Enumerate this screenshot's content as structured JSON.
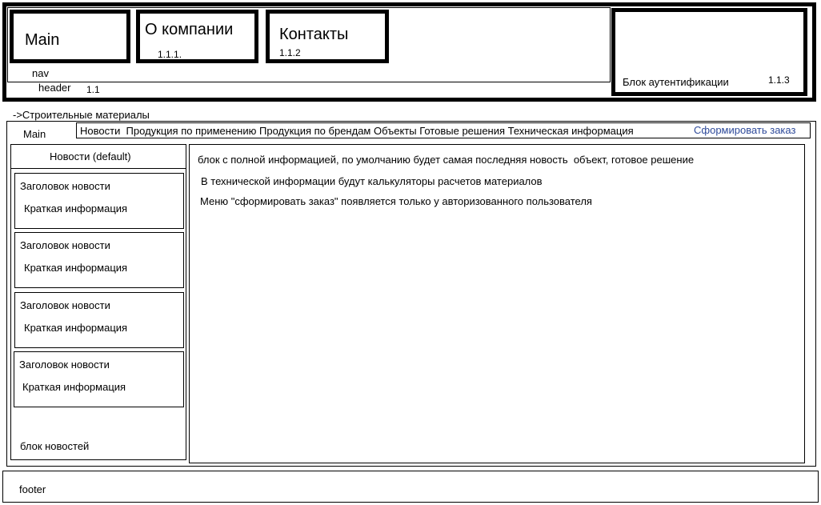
{
  "header": {
    "nav_items": [
      {
        "title": "Main",
        "code": ""
      },
      {
        "title": "О компании",
        "code": "1.1.1."
      },
      {
        "title": "Контакты",
        "code": "1.1.2"
      }
    ],
    "nav_label": "nav",
    "header_label": "header",
    "header_code": "1.1",
    "auth_label": "Блок аутентификации",
    "auth_code": "1.1.3"
  },
  "breadcrumb": "->Строительные материалы",
  "main": {
    "label": "Main",
    "menu": "Новости  Продукция по применению Продукция по брендам Объекты Готовые решения Техническая информация",
    "order_link": "Сформировать заказ",
    "order_link_color": "#2e4a9a",
    "sidebar": {
      "title": "Новости (default)",
      "items": [
        {
          "title": "Заголовок новости",
          "summary": "Краткая информация"
        },
        {
          "title": "Заголовок новости",
          "summary": "Краткая информация"
        },
        {
          "title": "Заголовок новости",
          "summary": "Краткая информация"
        },
        {
          "title": "Заголовок новости",
          "summary": "Краткая информация"
        }
      ],
      "footer_label": "блок новостей"
    },
    "content": {
      "line1": "блок с полной информацией, по умолчанию будет самая последняя новость  объект, готовое решение",
      "line2": "В технической информации будут калькуляторы расчетов материалов",
      "line3": "Меню \"сформировать заказ\" появляется только у авторизованного пользователя"
    }
  },
  "footer": {
    "label": "footer"
  }
}
